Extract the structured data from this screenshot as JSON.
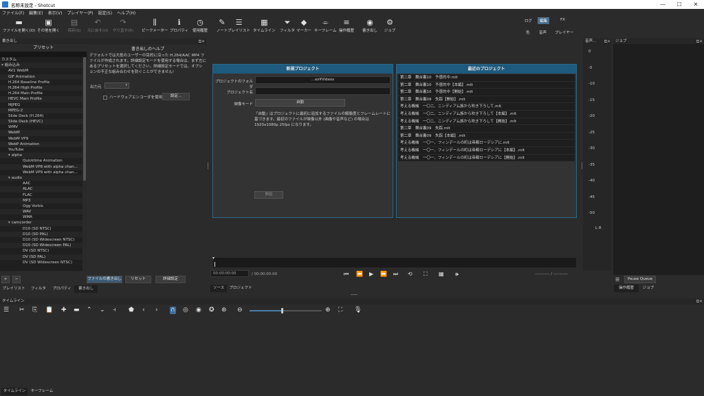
{
  "window": {
    "title": "名称未設定 - Shotcut",
    "controls": [
      "—",
      "☐",
      "✕"
    ]
  },
  "menu": [
    "ファイル(F)",
    "編集(E)",
    "表示(V)",
    "プレイヤー(P)",
    "設定(S)",
    "ヘルプ(H)"
  ],
  "toolbar": {
    "items": [
      {
        "icon": "▬",
        "label": "ファイルを開く(O)",
        "dim": false
      },
      {
        "icon": "▣",
        "label": "その他を開く",
        "dim": false
      },
      {
        "icon": "▤",
        "label": "保存(S)",
        "dim": true
      },
      {
        "icon": "↶",
        "label": "元に戻す(U)",
        "dim": true
      },
      {
        "icon": "↷",
        "label": "やり直す(R)",
        "dim": true
      },
      {
        "icon": "⫼",
        "label": "ピークメーター",
        "dim": false
      },
      {
        "icon": "ℹ",
        "label": "プロパティ",
        "dim": false
      },
      {
        "icon": "◷",
        "label": "使用履歴",
        "dim": false
      },
      {
        "icon": "✎",
        "label": "ノート",
        "dim": false
      },
      {
        "icon": "☰",
        "label": "プレイリスト",
        "dim": false
      },
      {
        "icon": "▦",
        "label": "タイムライン",
        "dim": false
      },
      {
        "icon": "⏷",
        "label": "フィルタ",
        "dim": false
      },
      {
        "icon": "◆",
        "label": "マーカー",
        "dim": false
      },
      {
        "icon": "⌯",
        "label": "キーフレーム",
        "dim": false
      },
      {
        "icon": "≡",
        "label": "操作履歴",
        "dim": false
      },
      {
        "icon": "◉",
        "label": "書き出し",
        "dim": false
      },
      {
        "icon": "⚙",
        "label": "ジョブ",
        "dim": false
      }
    ],
    "layouts_top": [
      "ログ",
      "編集",
      "FX"
    ],
    "layouts_bottom": [
      "色",
      "音声",
      "プレイヤー"
    ],
    "active_layout": "編集"
  },
  "export_panel": {
    "dock_title": "書き出し",
    "preset_header": "プリセット",
    "presets": [
      {
        "label": "カスタム",
        "level": 0,
        "arrow": ""
      },
      {
        "label": "組み込み",
        "level": 0,
        "arrow": "▾"
      },
      {
        "label": "AV1 WebM",
        "level": 1,
        "arrow": ""
      },
      {
        "label": "GIF Animation",
        "level": 1,
        "arrow": ""
      },
      {
        "label": "H.264 Baseline Profile",
        "level": 1,
        "arrow": ""
      },
      {
        "label": "H.264 High Profile",
        "level": 1,
        "arrow": ""
      },
      {
        "label": "H.264 Main Profile",
        "level": 1,
        "arrow": ""
      },
      {
        "label": "HEVC Main Profile",
        "level": 1,
        "arrow": ""
      },
      {
        "label": "MJPEG",
        "level": 1,
        "arrow": ""
      },
      {
        "label": "MPEG-2",
        "level": 1,
        "arrow": ""
      },
      {
        "label": "Slide Deck (H.264)",
        "level": 1,
        "arrow": ""
      },
      {
        "label": "Slide Deck (HEVC)",
        "level": 1,
        "arrow": ""
      },
      {
        "label": "WMV",
        "level": 1,
        "arrow": ""
      },
      {
        "label": "WebM",
        "level": 1,
        "arrow": ""
      },
      {
        "label": "WebM VP9",
        "level": 1,
        "arrow": ""
      },
      {
        "label": "WebP Animation",
        "level": 1,
        "arrow": ""
      },
      {
        "label": "YouTube",
        "level": 1,
        "arrow": ""
      },
      {
        "label": "alpha",
        "level": 1,
        "arrow": "▾"
      },
      {
        "label": "Quicktime Animation",
        "level": 2,
        "arrow": ""
      },
      {
        "label": "WebM VP8 with alpha chan...",
        "level": 2,
        "arrow": ""
      },
      {
        "label": "WebM VP9 with alpha chan...",
        "level": 2,
        "arrow": ""
      },
      {
        "label": "audio",
        "level": 1,
        "arrow": "▾"
      },
      {
        "label": "AAC",
        "level": 2,
        "arrow": ""
      },
      {
        "label": "ALAC",
        "level": 2,
        "arrow": ""
      },
      {
        "label": "FLAC",
        "level": 2,
        "arrow": ""
      },
      {
        "label": "MP3",
        "level": 2,
        "arrow": ""
      },
      {
        "label": "Ogg Vorbis",
        "level": 2,
        "arrow": ""
      },
      {
        "label": "WAV",
        "level": 2,
        "arrow": ""
      },
      {
        "label": "WMA",
        "level": 2,
        "arrow": ""
      },
      {
        "label": "camcorder",
        "level": 1,
        "arrow": "▾"
      },
      {
        "label": "D10 (SD NTSC)",
        "level": 2,
        "arrow": ""
      },
      {
        "label": "D10 (SD PAL)",
        "level": 2,
        "arrow": ""
      },
      {
        "label": "D10 (SD Widescreen NTSC)",
        "level": 2,
        "arrow": ""
      },
      {
        "label": "D10 (SD Widescreen PAL)",
        "level": 2,
        "arrow": ""
      },
      {
        "label": "DV (SD NTSC)",
        "level": 2,
        "arrow": ""
      },
      {
        "label": "DV (SD PAL)",
        "level": 2,
        "arrow": ""
      },
      {
        "label": "DV (SD Widescreen NTSC)",
        "level": 2,
        "arrow": ""
      }
    ],
    "help_title": "書き出しのヘルプ",
    "help_text": "デフォルトでは大抵のユーザーの目的に沿った H.264/AAC MP4 ファイルが作成されます。詳細設定モードを使用する場合は、まず左にあるプリセットを選択してください。詳細設定モードでは、オプションの不正な組み合わせを防ぐことができません!",
    "output_label": "出力元",
    "hw_encoder_label": "ハードウェアエンコーダを使用",
    "settings_button": "設定...",
    "add_button": "+",
    "remove_button": "−",
    "export_file_button": "ファイルの書き出し",
    "reset_button": "リセット",
    "advanced_button": "詳細設定",
    "tabs": [
      "プレイリスト",
      "フィルタ",
      "プロパティ",
      "書き出し"
    ]
  },
  "new_project": {
    "header": "新規プロジェクト",
    "folder_label": "プロジェクトのフォルダ",
    "folder_value": "...es¥Videos",
    "name_label": "プロジェクト名",
    "name_value": "",
    "mode_label": "映像モード",
    "mode_value": "自動",
    "description": "「自動」はプロジェクトに最初に追加するファイルの解像度とフレームレートに基づきます。最初のファイルが映像以外 (画像や音声など) の場合は 1920x1080p 25fps になります。",
    "start_button": "開始"
  },
  "recent_projects": {
    "header": "最近のプロジェクト",
    "items": [
      "第二章　舞台裏10　予感的中.mlt",
      "第二章　舞台裏10　予感的中【本編】.mlt",
      "第二章　舞台裏10　予感的中【開始】.mlt",
      "第二章　舞台裏09　失踪【開始】.mlt",
      "考える機械　一〇二、ニンディアム族から吹き下ろして.mlt",
      "考える機械　一〇二、ニンディアム族から吹き下ろして【本編】.mlt",
      "考える機械　一〇二、ニンディアム族から吹き下ろして【開始】.mlt",
      "第二章　舞台裏09　失踪.mlt",
      "第二章　舞台裏09　失踪【本編】.mlt",
      "考える機械　一〇一、フィンデールの町は帝都ローデシアに.mlt",
      "考える機械　一〇一、フィンデールの町は帝都ローデシアに【本編】.mlt",
      "考える機械　一〇一、フィンデールの町は帝都ローデシアに【開始】.mlt"
    ]
  },
  "player": {
    "timecode_current": "00:00:00:00",
    "timecode_total": "/ 00:00:00:00",
    "in_out": "--:--:--:-- / --:--:--:--",
    "tabs": [
      "ソース",
      "プロジェクト"
    ]
  },
  "audio_meter": {
    "title": "音声...",
    "scale": [
      "0",
      "-5",
      "-10",
      "-15",
      "-20",
      "-25",
      "-30",
      "-35",
      "-40",
      "-45",
      "-50"
    ],
    "channels": "L  R"
  },
  "jobs": {
    "title": "ジョブ",
    "menu_icon": "☰",
    "pause_queue": "Pause Queue",
    "tabs": [
      "操作履歴",
      "ジョブ"
    ]
  },
  "timeline": {
    "title": "タイムライン",
    "tabs": [
      "タイムライン",
      "キーフレーム"
    ],
    "zoom_fraction": 0.45
  }
}
